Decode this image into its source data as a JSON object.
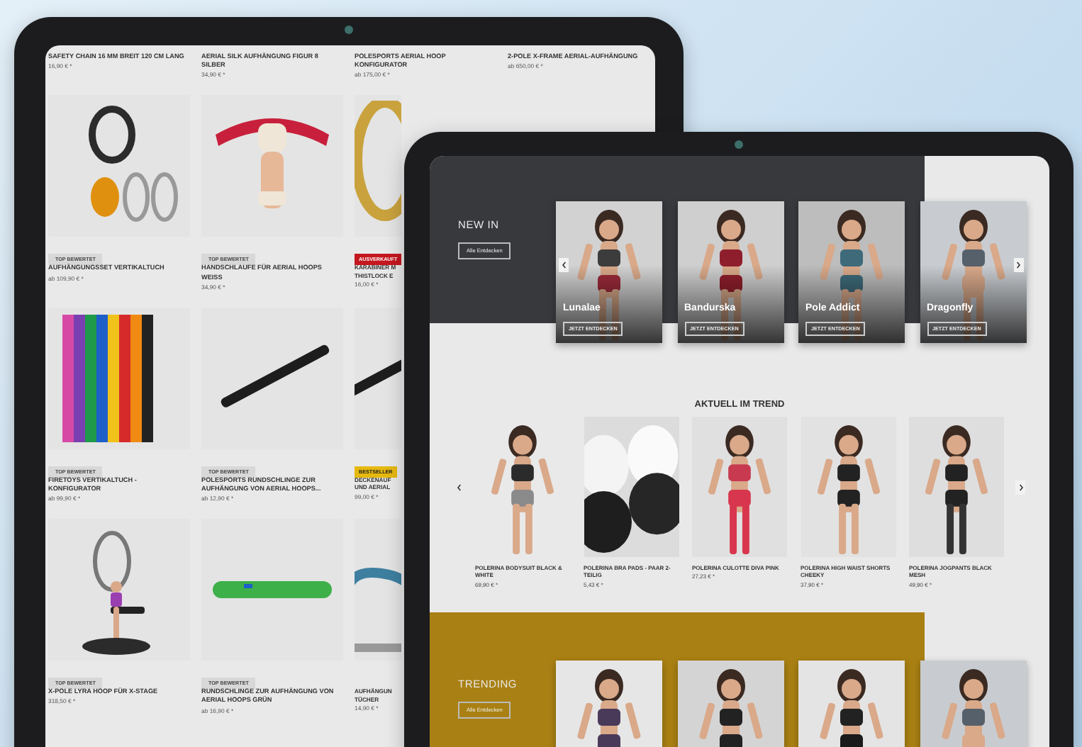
{
  "back_tablet": {
    "top_products": [
      {
        "name": "SAFETY CHAIN 16 MM BREIT 120 CM LANG",
        "price": "16,90 € *"
      },
      {
        "name": "AERIAL SILK AUFHÄNGUNG FIGUR 8 SILBER",
        "price": "34,90 € *"
      },
      {
        "name": "POLESPORTS AERIAL HOOP KONFIGURATOR",
        "price": "ab 175,00 € *"
      },
      {
        "name": "2-POLE X-FRAME AERIAL-AUFHÄNGUNG",
        "price": "ab 650,00 € *"
      }
    ],
    "product_rows": [
      [
        {
          "badge": {
            "label": "TOP BEWERTET",
            "kind": "top"
          },
          "name": "AUFHÄNGUNGSSET VERTIKALTUCH",
          "price": "ab 109,90 € *"
        },
        {
          "badge": {
            "label": "TOP BEWERTET",
            "kind": "top"
          },
          "name": "HANDSCHLAUFE FÜR AERIAL HOOPS WEISS",
          "price": "34,90 € *"
        },
        {
          "badge": {
            "label": "AUSVERKAUFT",
            "kind": "sold_out"
          },
          "name": "KARABINER M THISTLOCK E",
          "price": "16,00 € *"
        }
      ],
      [
        {
          "badge": {
            "label": "TOP BEWERTET",
            "kind": "top"
          },
          "name": "FIRETOYS VERTIKALTUCH - KONFIGURATOR",
          "price": "ab 99,90 € *"
        },
        {
          "badge": {
            "label": "TOP BEWERTET",
            "kind": "top"
          },
          "name": "POLESPORTS RUNDSCHLINGE ZUR AUFHÄNGUNG VON AERIAL HOOPS...",
          "price": "ab 12,90 € *"
        },
        {
          "badge": {
            "label": "BESTSELLER",
            "kind": "bestseller"
          },
          "name": "DECKENAUF UND AERIAL",
          "price": "99,00 € *"
        }
      ],
      [
        {
          "badge": {
            "label": "TOP BEWERTET",
            "kind": "top"
          },
          "name": "X-POLE LYRA HOOP FÜR X-STAGE",
          "price": "318,50 € *"
        },
        {
          "badge": {
            "label": "TOP BEWERTET",
            "kind": "top"
          },
          "name": "RUNDSCHLINGE ZUR AUFHÄNGUNG VON AERIAL HOOPS GRÜN",
          "price": "ab 16,90 € *"
        },
        {
          "name": "AUFHÄNGUN TÜCHER",
          "price": "14,90 € *"
        }
      ]
    ]
  },
  "front_tablet": {
    "new_in": {
      "title": "NEW IN",
      "button": "Alle Entdecken",
      "cards": [
        {
          "name": "Lunalae",
          "button": "JETZT ENTDECKEN"
        },
        {
          "name": "Bandurska",
          "button": "JETZT ENTDECKEN"
        },
        {
          "name": "Pole Addict",
          "button": "JETZT ENTDECKEN"
        },
        {
          "name": "Dragonfly",
          "button": "JETZT ENTDECKEN"
        }
      ]
    },
    "trend": {
      "title": "AKTUELL IM TREND",
      "products": [
        {
          "name": "POLERINA BODYSUIT BLACK & WHITE",
          "price": "69,90 € *"
        },
        {
          "name": "POLERINA BRA PADS - PAAR 2-TEILIG",
          "price": "5,43 € *"
        },
        {
          "name": "POLERINA CULOTTE DIVA PINK",
          "price": "27,23 € *"
        },
        {
          "name": "POLERINA HIGH WAIST SHORTS CHEEKY",
          "price": "37,90 € *"
        },
        {
          "name": "POLERINA JOGPANTS BLACK MESH",
          "price": "49,90 € *"
        }
      ]
    },
    "trending": {
      "title": "TRENDING",
      "button": "Alle Entdecken"
    }
  }
}
